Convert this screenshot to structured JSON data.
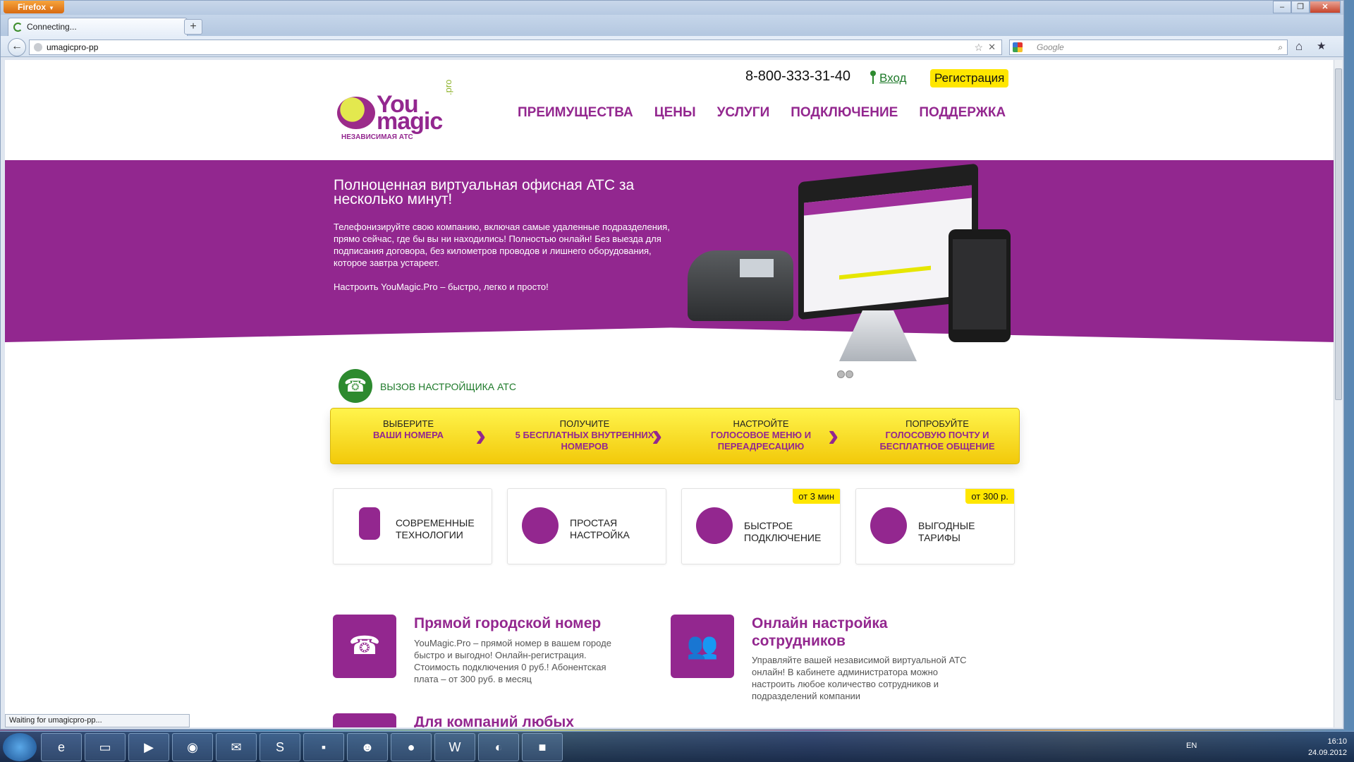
{
  "browser": {
    "menu_label": "Firefox",
    "tab_title": "Connecting...",
    "url": "umagicpro-pp",
    "search_placeholder": "Google",
    "status_text": "Waiting for umagicpro-pp..."
  },
  "site": {
    "logo_you": "You",
    "logo_magic": "magic",
    "logo_pro": ".pro",
    "logo_tagline": "НЕЗАВИСИМАЯ АТС",
    "phone": "8-800-333-31-40",
    "login": "Вход",
    "register": "Регистрация",
    "nav": [
      "ПРЕИМУЩЕСТВА",
      "ЦЕНЫ",
      "УСЛУГИ",
      "ПОДКЛЮЧЕНИЕ",
      "ПОДДЕРЖКА"
    ],
    "hero": {
      "title": "Полноценная виртуальная офисная АТС за несколько минут!",
      "text": "Телефонизируйте свою компанию, включая самые удаленные подразделения, прямо сейчас, где бы вы ни находились! Полностью онлайн! Без выезда для подписания договора, без километров проводов и лишнего оборудования, которое завтра устареет.",
      "text2": "Настроить YouMagic.Pro – быстро, легко и просто!"
    },
    "call_installer": "ВЫЗОВ НАСТРОЙЩИКА АТС",
    "steps": [
      {
        "l1": "ВЫБЕРИТЕ",
        "l2": "ВАШИ НОМЕРА"
      },
      {
        "l1": "ПОЛУЧИТЕ",
        "l2": "5 БЕСПЛАТНЫХ ВНУТРЕННИХ НОМЕРОВ"
      },
      {
        "l1": "НАСТРОЙТЕ",
        "l2": "ГОЛОСОВОЕ МЕНЮ И ПЕРЕАДРЕСАЦИЮ"
      },
      {
        "l1": "ПОПРОБУЙТЕ",
        "l2": "ГОЛОСОВУЮ ПОЧТУ И БЕСПЛАТНОЕ ОБЩЕНИЕ"
      }
    ],
    "features": [
      {
        "line1": "СОВРЕМЕННЫЕ",
        "line2": "ТЕХНОЛОГИИ",
        "badge": "",
        "icon": "mobile-phone-icon"
      },
      {
        "line1": "ПРОСТАЯ",
        "line2": "НАСТРОЙКА",
        "badge": "",
        "icon": "smiley-icon"
      },
      {
        "line1": "БЫСТРОЕ",
        "line2": "ПОДКЛЮЧЕНИЕ",
        "badge": "от 3 мин",
        "icon": "bird-icon"
      },
      {
        "line1": "ВЫГОДНЫЕ",
        "line2": "ТАРИФЫ",
        "badge": "от 300 р.",
        "icon": "coins-icon"
      }
    ],
    "blocks": [
      {
        "title": "Прямой городской номер",
        "text": "YouMagic.Pro – прямой номер в вашем городе быстро и выгодно! Онлайн-регистрация. Стоимость подключения 0 руб.! Абонентская плата – от 300 руб. в месяц",
        "icon": "telephone-icon"
      },
      {
        "title": "Онлайн настройка сотрудников",
        "text": "Управляйте вашей независимой виртуальной АТС онлайн! В кабинете администратора можно настроить любое количество сотрудников и подразделений компании",
        "icon": "people-icon"
      },
      {
        "title": "Для компаний любых",
        "text": "",
        "icon": "building-icon"
      }
    ]
  },
  "taskbar": {
    "lang": "EN",
    "time": "16:10",
    "date": "24.09.2012"
  },
  "colors": {
    "brand_purple": "#93278f",
    "accent_yellow": "#ffe600",
    "green": "#1e7a2a"
  }
}
